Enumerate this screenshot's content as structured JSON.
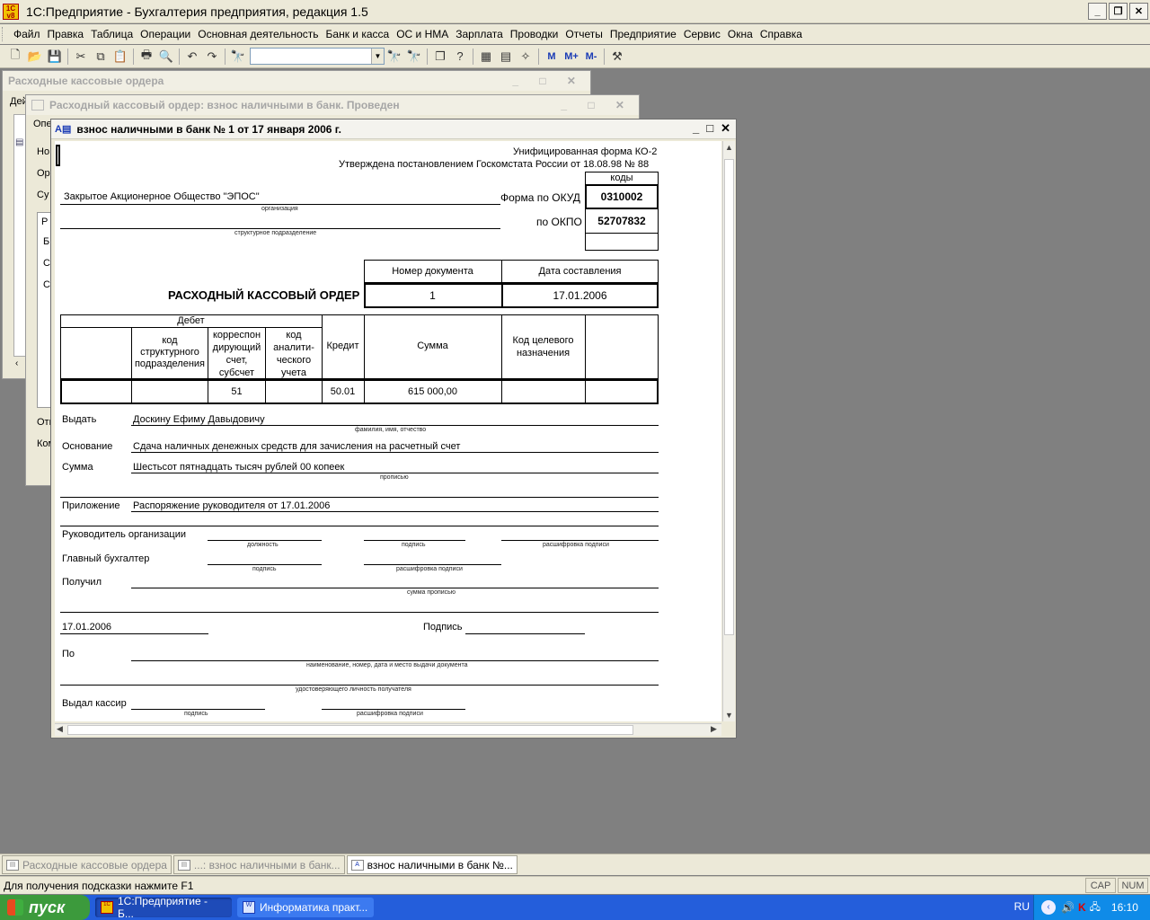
{
  "app": {
    "title": "1С:Предприятие - Бухгалтерия предприятия, редакция 1.5",
    "logo": "1С v8"
  },
  "menu": [
    "Файл",
    "Правка",
    "Таблица",
    "Операции",
    "Основная деятельность",
    "Банк и касса",
    "ОС и НМА",
    "Зарплата",
    "Проводки",
    "Отчеты",
    "Предприятие",
    "Сервис",
    "Окна",
    "Справка"
  ],
  "toolbar": {
    "icons": [
      "new-doc-icon",
      "open-icon",
      "save-icon",
      "cut-icon",
      "copy-icon",
      "paste-icon",
      "print-icon",
      "preview-icon",
      "undo-icon",
      "redo-icon",
      "find-icon"
    ],
    "search_value": "",
    "mem_buttons": [
      "M",
      "M+",
      "M-"
    ]
  },
  "bg_windows": {
    "w1_title": "Расходные кассовые ордера",
    "w2_title": "Расходный кассовый ордер: взнос наличными в банк. Проведен",
    "w1_side_labels": [
      "Дей",
      "Опе",
      "Но",
      "Ор",
      "Су",
      "Р",
      "Б",
      "С",
      "С",
      "Отв",
      "Ком"
    ]
  },
  "doc": {
    "title": "взнос наличными в банк № 1 от 17 января 2006 г.",
    "form_header_1": "Унифицированная форма КО-2",
    "form_header_2": "Утверждена постановлением Госкомстата России от 18.08.98 № 88",
    "codes_label": "коды",
    "okud_label": "Форма по ОКУД",
    "okud_value": "0310002",
    "okpo_label": "по ОКПО",
    "okpo_value": "52707832",
    "org_name": "Закрытое Акционерное Общество \"ЭПОС\"",
    "org_caption": "организация",
    "subdiv_caption": "структурное подразделение",
    "doc_no_label": "Номер документа",
    "doc_date_label": "Дата составления",
    "doc_heading": "РАСХОДНЫЙ КАССОВЫЙ ОРДЕР",
    "doc_no": "1",
    "doc_date": "17.01.2006",
    "table": {
      "debet": "Дебет",
      "col_subdiv": "код структурного подразделения",
      "col_account": "корреспон дирующий счет, субсчет",
      "col_analytic": "код аналити-ческого учета",
      "col_credit": "Кредит",
      "col_sum": "Сумма",
      "col_purpose": "Код целевого назначения",
      "row_account": "51",
      "row_credit": "50.01",
      "row_sum": "615 000,00"
    },
    "issue_label": "Выдать",
    "issue_value": "Доскину Ефиму Давыдовичу",
    "issue_caption": "фамилия, имя, отчество",
    "basis_label": "Основание",
    "basis_value": "Сдача наличных денежных средств для зачисления на расчетный счет",
    "sum_label": "Сумма",
    "sum_value": "Шестьсот пятнадцать тысяч рублей 00 копеек",
    "sum_caption": "прописью",
    "attach_label": "Приложение",
    "attach_value": "Распоряжение руководителя от 17.01.2006",
    "head_label": "Руководитель организации",
    "cap_position": "должность",
    "cap_signature": "подпись",
    "cap_decode": "расшифровка подписи",
    "chief_acc_label": "Главный бухгалтер",
    "received_label": "Получил",
    "cap_sum_words": "сумма прописью",
    "bottom_date": "17.01.2006",
    "sign_label": "Подпись",
    "po_label": "По",
    "cap_id_doc": "наименование, номер, дата и место выдачи документа",
    "cap_id_person": "удостоверяющего личность получателя",
    "cashier_label": "Выдал кассир"
  },
  "window_tabs": [
    "Расходные кассовые ордера",
    "...: взнос наличными в банк...",
    "взнос наличными в банк №..."
  ],
  "status": {
    "hint": "Для получения подсказки нажмите F1",
    "cap": "CAP",
    "num": "NUM"
  },
  "taskbar": {
    "start": "пуск",
    "tasks": [
      "1С:Предприятие - Б...",
      "Информатика практ..."
    ],
    "lang": "RU",
    "time": "16:10"
  }
}
